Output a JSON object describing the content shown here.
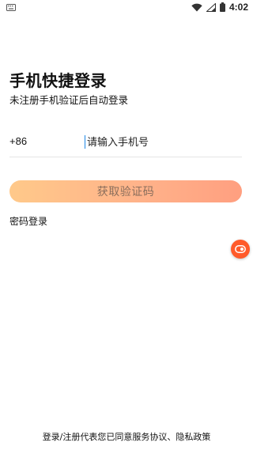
{
  "status_bar": {
    "time": "4:02"
  },
  "login": {
    "title": "手机快捷登录",
    "subtitle": "未注册手机验证后自动登录",
    "country_code": "+86",
    "phone_placeholder": "请输入手机号",
    "phone_value": "",
    "get_code_label": "获取验证码",
    "password_login_label": "密码登录"
  },
  "agreement": {
    "prefix": "登录/注册代表您已同意",
    "service_agreement": "服务协议",
    "separator": "、",
    "privacy_policy": "隐私政策"
  },
  "colors": {
    "button_gradient_start": "#ffc98a",
    "button_gradient_end": "#ff9f80",
    "button_text": "#8a6e5c",
    "float_button": "#ff5a2a",
    "cursor": "#1e88e5"
  },
  "icons": {
    "notification": "keyboard-icon",
    "wifi": "wifi-icon",
    "signal": "signal-icon",
    "battery": "battery-icon",
    "float": "float-assistant-icon"
  }
}
